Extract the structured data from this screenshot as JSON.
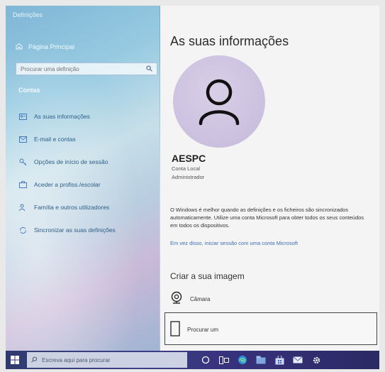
{
  "left": {
    "app_title": "Definições",
    "home_label": "Página Principal",
    "search_placeholder": "Procurar uma definição",
    "section_label": "Contas",
    "nav": [
      {
        "label": "As suas informações",
        "icon": "person-card-icon"
      },
      {
        "label": "E-mail e contas",
        "icon": "mail-icon"
      },
      {
        "label": "Opções de início de sessão",
        "icon": "key-icon"
      },
      {
        "label": "Aceder a profiss./escolar",
        "icon": "briefcase-icon"
      },
      {
        "label": "Família e outros utilizadores",
        "icon": "people-icon"
      },
      {
        "label": "Sincronizar as suas definições",
        "icon": "sync-icon"
      }
    ]
  },
  "main": {
    "title": "As suas informações",
    "user_name": "AESPC",
    "account_type": "Conta Local",
    "account_role": "Administrador",
    "info_text": "O Windows é melhor quando as definições e os ficheiros são sincronizados automaticamente. Utilize uma conta Microsoft para obter todos os seus conteúdos em todos os dispositivos.",
    "signin_link": "Em vez disso, iniciar sessão com uma conta Microsoft",
    "create_title": "Criar a sua imagem",
    "camera_label": "Câmara",
    "browse_label": "Procurar um"
  },
  "taskbar": {
    "search_placeholder": "Escreva aqui para procurar",
    "icons": [
      "cortana-icon",
      "task-view-icon",
      "edge-icon",
      "explorer-icon",
      "store-icon",
      "mail-icon",
      "settings-icon"
    ]
  },
  "colors": {
    "accent": "#3b6fb6",
    "taskbar": "#33367a"
  }
}
